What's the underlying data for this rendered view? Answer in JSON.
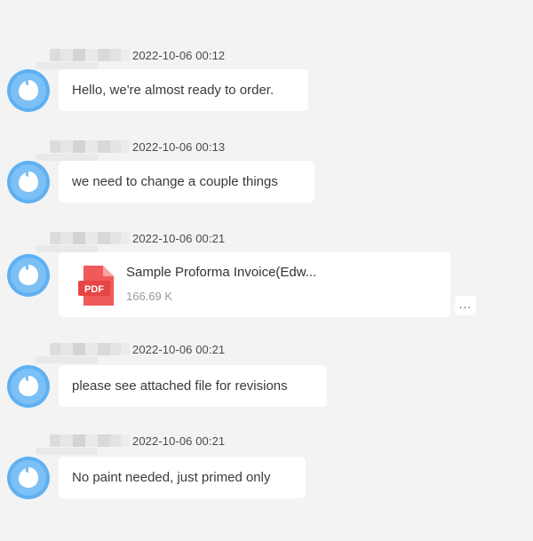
{
  "chat": {
    "messages": [
      {
        "sender_redacted": true,
        "time": "2022-10-06 00:12",
        "text": "Hello, we're almost ready to order."
      },
      {
        "sender_redacted": true,
        "time": "2022-10-06 00:13",
        "text": "we need to change a couple things"
      },
      {
        "sender_redacted": true,
        "time": "2022-10-06 00:21",
        "type": "file",
        "file_name": "Sample Proforma Invoice(Edw...",
        "file_size": "166.69 K",
        "file_icon": "pdf-icon",
        "file_icon_label": "PDF"
      },
      {
        "sender_redacted": true,
        "time": "2022-10-06 00:21",
        "text": "please see attached file for revisions"
      },
      {
        "sender_redacted": true,
        "time": "2022-10-06 00:21",
        "text": "No paint needed, just primed only"
      }
    ],
    "more_label": "...",
    "avatar_icon": "avatar-icon",
    "colors": {
      "background": "#f3f3f4",
      "bubble": "#ffffff",
      "avatar": "#4aa3f0",
      "pdf": "#f05a5a"
    }
  }
}
